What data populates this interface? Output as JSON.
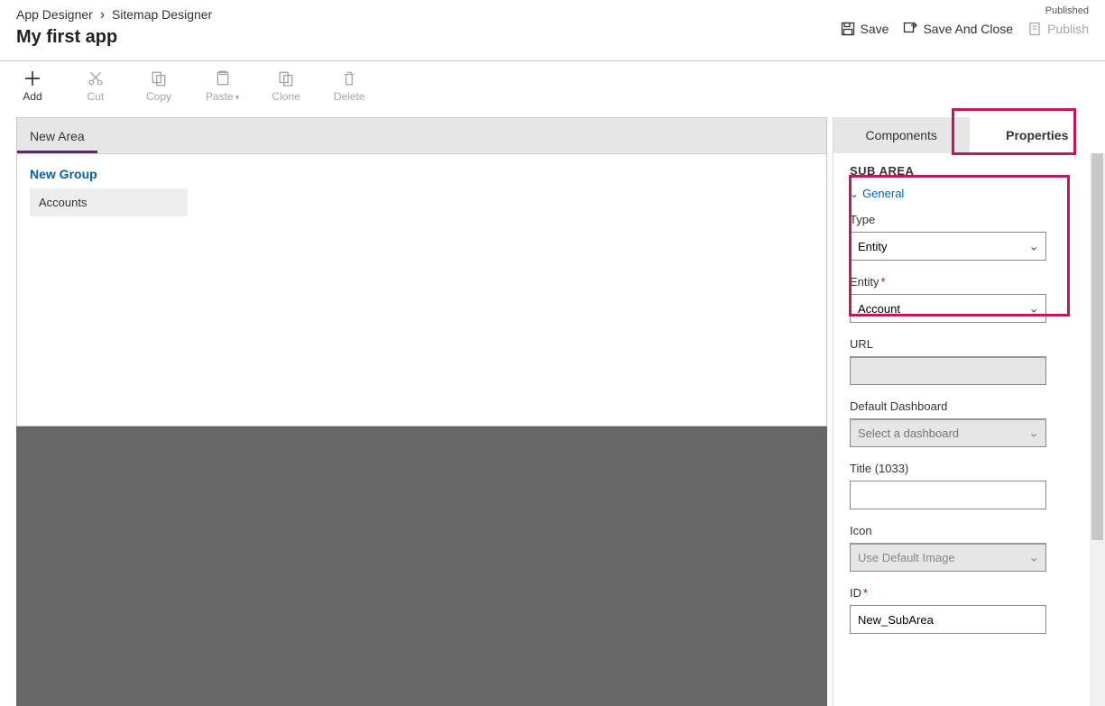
{
  "breadcrumb": {
    "item1": "App Designer",
    "item2": "Sitemap Designer"
  },
  "app_title": "My first app",
  "status": "Published",
  "header_actions": {
    "save": "Save",
    "save_close": "Save And Close",
    "publish": "Publish"
  },
  "toolbar": {
    "add": "Add",
    "cut": "Cut",
    "copy": "Copy",
    "paste": "Paste",
    "clone": "Clone",
    "delete": "Delete"
  },
  "canvas": {
    "area": "New Area",
    "group": "New Group",
    "subarea": "Accounts"
  },
  "side_tabs": {
    "components": "Components",
    "properties": "Properties"
  },
  "panel": {
    "title": "SUB AREA",
    "section_general": "General",
    "fields": {
      "type": {
        "label": "Type",
        "value": "Entity"
      },
      "entity": {
        "label": "Entity",
        "value": "Account"
      },
      "url": {
        "label": "URL",
        "value": ""
      },
      "dashboard": {
        "label": "Default Dashboard",
        "placeholder": "Select a dashboard"
      },
      "title": {
        "label": "Title (1033)",
        "value": ""
      },
      "icon": {
        "label": "Icon",
        "value": "Use Default Image"
      },
      "id": {
        "label": "ID",
        "value": "New_SubArea"
      }
    }
  }
}
